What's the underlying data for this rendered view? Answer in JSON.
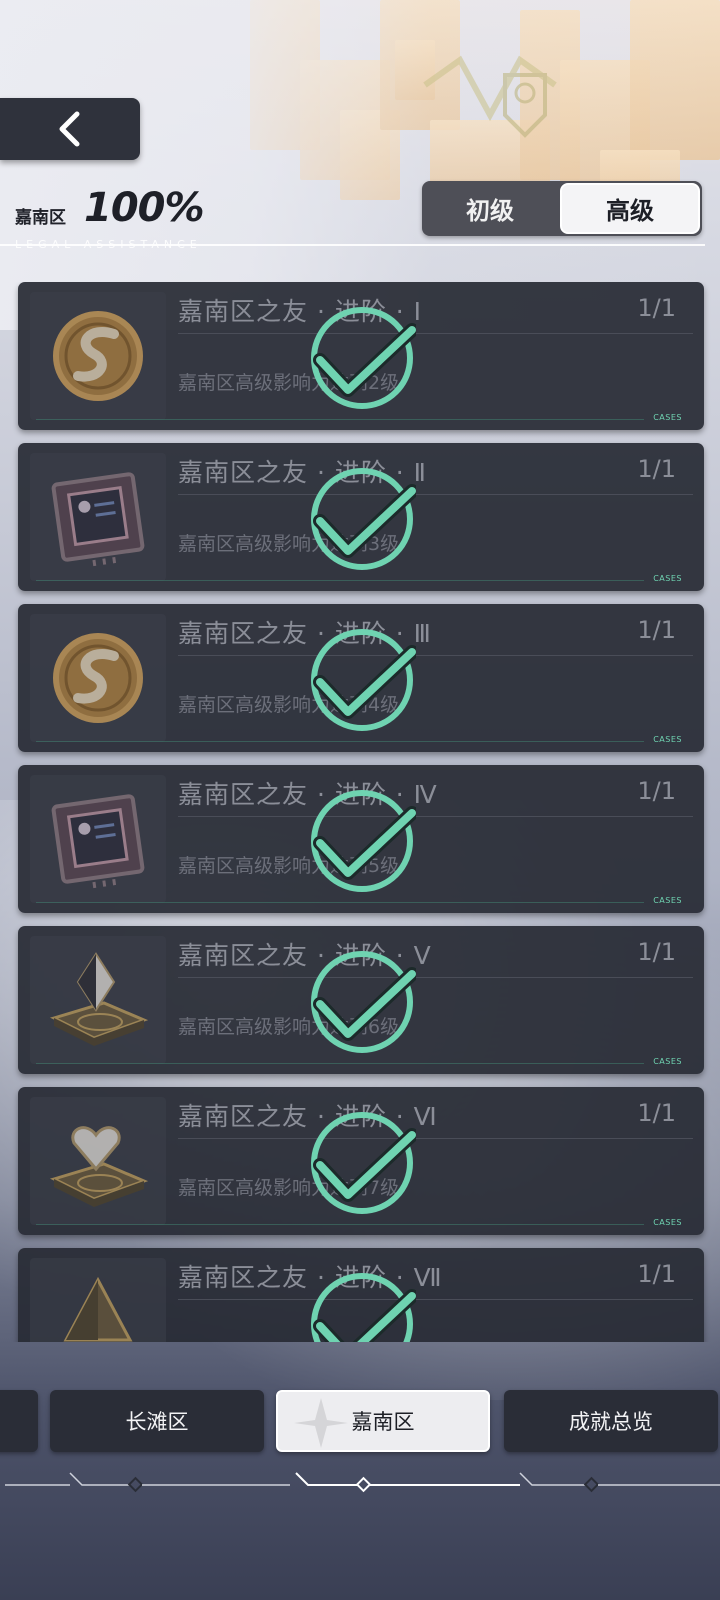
{
  "header": {
    "district": "嘉南区",
    "percent": "100%",
    "subtitle": "LEGAL ASSISTANCE",
    "tiers": [
      {
        "label": "初级",
        "active": false
      },
      {
        "label": "高级",
        "active": true
      }
    ]
  },
  "achievements": [
    {
      "title": "嘉南区之友 · 进阶 · Ⅰ",
      "count": "1/1",
      "desc": "嘉南区高级影响力达到2级",
      "icon": "coin-icon",
      "done": true
    },
    {
      "title": "嘉南区之友 · 进阶 · Ⅱ",
      "count": "1/1",
      "desc": "嘉南区高级影响力达到3级",
      "icon": "chip-icon",
      "done": true
    },
    {
      "title": "嘉南区之友 · 进阶 · Ⅲ",
      "count": "1/1",
      "desc": "嘉南区高级影响力达到4级",
      "icon": "coin-icon",
      "done": true
    },
    {
      "title": "嘉南区之友 · 进阶 · Ⅳ",
      "count": "1/1",
      "desc": "嘉南区高级影响力达到5级",
      "icon": "chip-icon",
      "done": true
    },
    {
      "title": "嘉南区之友 · 进阶 · Ⅴ",
      "count": "1/1",
      "desc": "嘉南区高级影响力达到6级",
      "icon": "diamond-platform-icon",
      "done": true
    },
    {
      "title": "嘉南区之友 · 进阶 · Ⅵ",
      "count": "1/1",
      "desc": "嘉南区高级影响力达到7级",
      "icon": "heart-platform-icon",
      "done": true
    },
    {
      "title": "嘉南区之友 · 进阶 · Ⅶ",
      "count": "1/1",
      "desc": "",
      "icon": "pyramid-icon",
      "done": true
    }
  ],
  "cases_label": "CASES",
  "bottom_nav": {
    "tabs": [
      {
        "label": "长滩区",
        "active": false
      },
      {
        "label": "嘉南区",
        "active": true
      },
      {
        "label": "成就总览",
        "active": false
      }
    ]
  },
  "colors": {
    "accent_check": "#6fd3b1",
    "card_bg": "#282b35",
    "tab_active": "#ededf0"
  }
}
